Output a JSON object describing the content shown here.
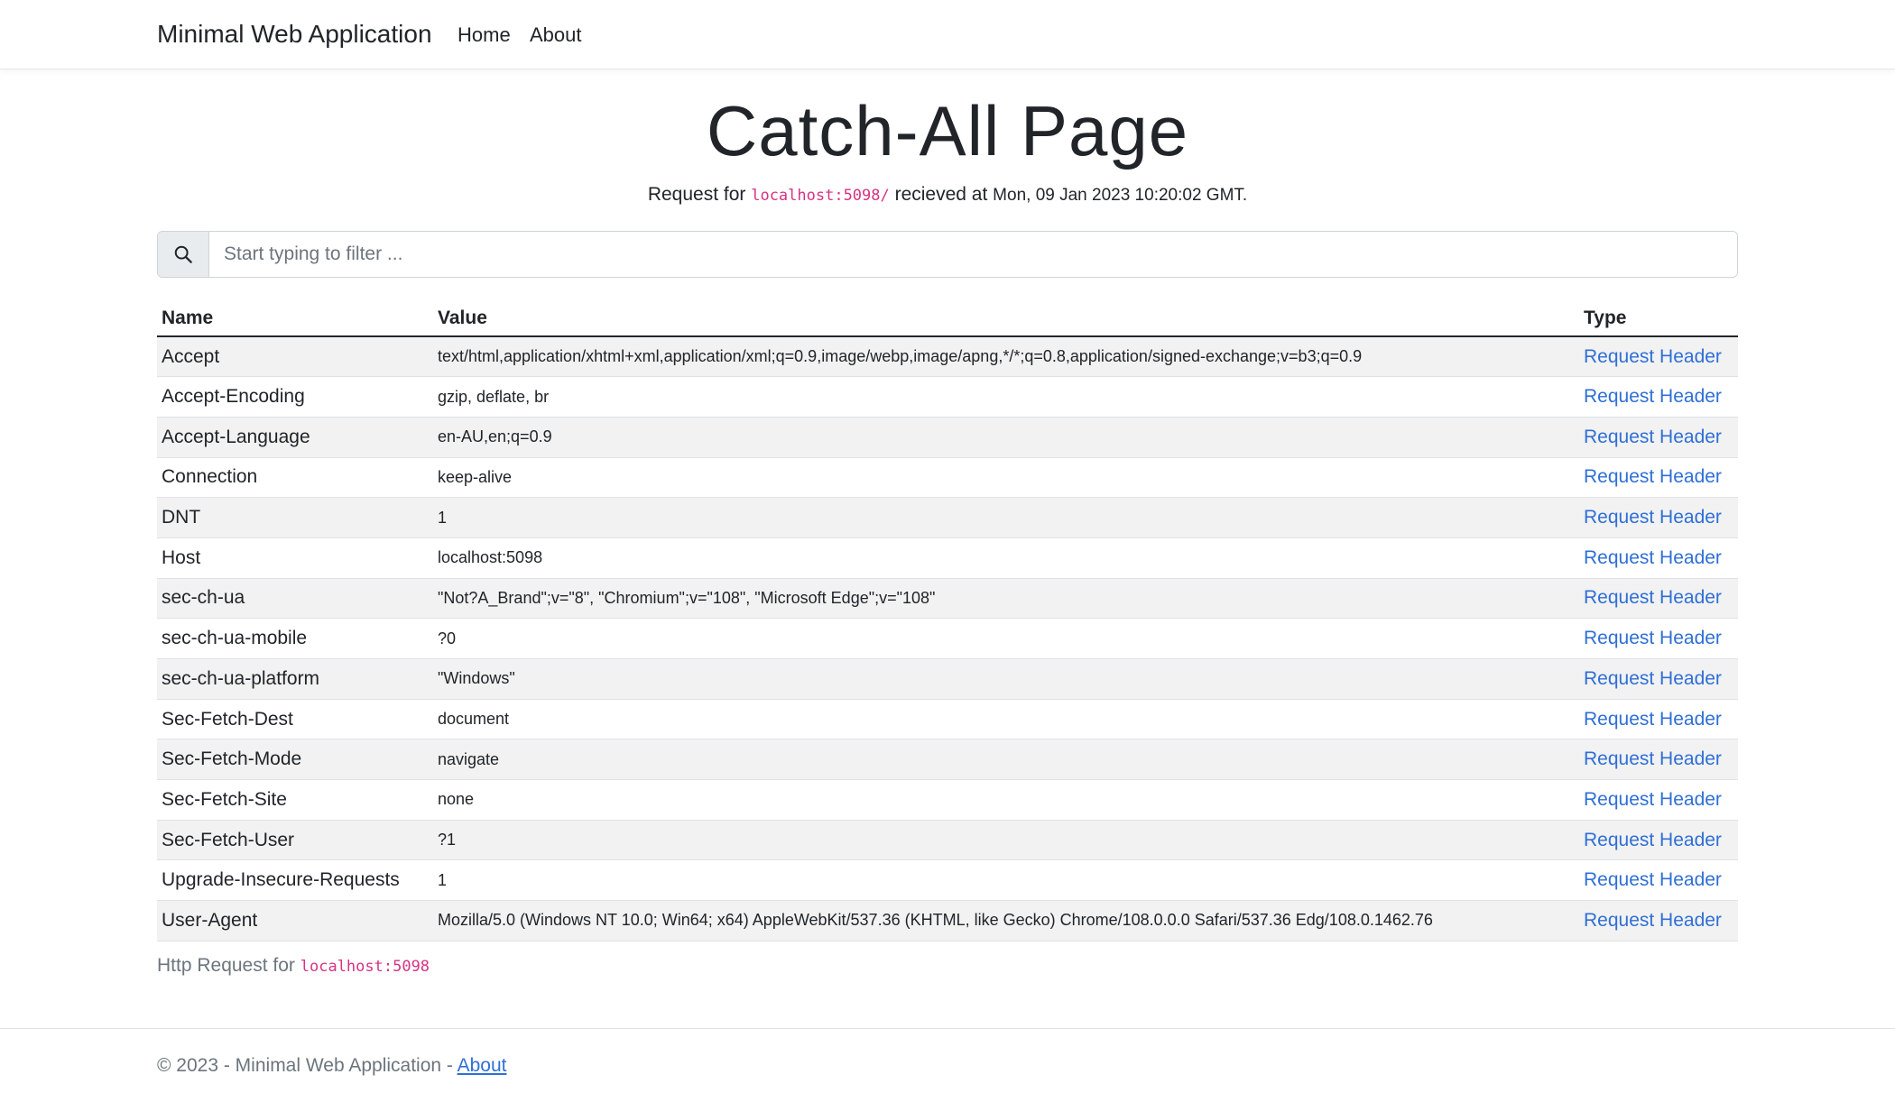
{
  "navbar": {
    "brand": "Minimal Web Application",
    "links": [
      "Home",
      "About"
    ]
  },
  "page": {
    "title": "Catch-All Page",
    "request_prefix": "Request for",
    "request_url": "localhost:5098/",
    "received_text": "recieved at",
    "timestamp": "Mon, 09 Jan 2023 10:20:02 GMT."
  },
  "search": {
    "placeholder": "Start typing to filter ...",
    "value": "",
    "icon": "search-icon"
  },
  "table": {
    "headers": [
      "Name",
      "Value",
      "Type"
    ],
    "rows": [
      {
        "name": "Accept",
        "value": "text/html,application/xhtml+xml,application/xml;q=0.9,image/webp,image/apng,*/*;q=0.8,application/signed-exchange;v=b3;q=0.9",
        "type": "Request Header"
      },
      {
        "name": "Accept-Encoding",
        "value": "gzip, deflate, br",
        "type": "Request Header"
      },
      {
        "name": "Accept-Language",
        "value": "en-AU,en;q=0.9",
        "type": "Request Header"
      },
      {
        "name": "Connection",
        "value": "keep-alive",
        "type": "Request Header"
      },
      {
        "name": "DNT",
        "value": "1",
        "type": "Request Header"
      },
      {
        "name": "Host",
        "value": "localhost:5098",
        "type": "Request Header"
      },
      {
        "name": "sec-ch-ua",
        "value": "\"Not?A_Brand\";v=\"8\", \"Chromium\";v=\"108\", \"Microsoft Edge\";v=\"108\"",
        "type": "Request Header"
      },
      {
        "name": "sec-ch-ua-mobile",
        "value": "?0",
        "type": "Request Header"
      },
      {
        "name": "sec-ch-ua-platform",
        "value": "\"Windows\"",
        "type": "Request Header"
      },
      {
        "name": "Sec-Fetch-Dest",
        "value": "document",
        "type": "Request Header"
      },
      {
        "name": "Sec-Fetch-Mode",
        "value": "navigate",
        "type": "Request Header"
      },
      {
        "name": "Sec-Fetch-Site",
        "value": "none",
        "type": "Request Header"
      },
      {
        "name": "Sec-Fetch-User",
        "value": "?1",
        "type": "Request Header"
      },
      {
        "name": "Upgrade-Insecure-Requests",
        "value": "1",
        "type": "Request Header"
      },
      {
        "name": "User-Agent",
        "value": "Mozilla/5.0 (Windows NT 10.0; Win64; x64) AppleWebKit/537.36 (KHTML, like Gecko) Chrome/108.0.0.0 Safari/537.36 Edg/108.0.1462.76",
        "type": "Request Header"
      }
    ]
  },
  "http_request": {
    "prefix": "Http Request for",
    "host": "localhost:5098"
  },
  "footer": {
    "text": "© 2023 - Minimal Web Application - ",
    "link": "About"
  },
  "colors": {
    "link": "#2f6fd6",
    "code": "#d63384",
    "stripe": "#f2f2f2",
    "muted": "#6c757d"
  }
}
